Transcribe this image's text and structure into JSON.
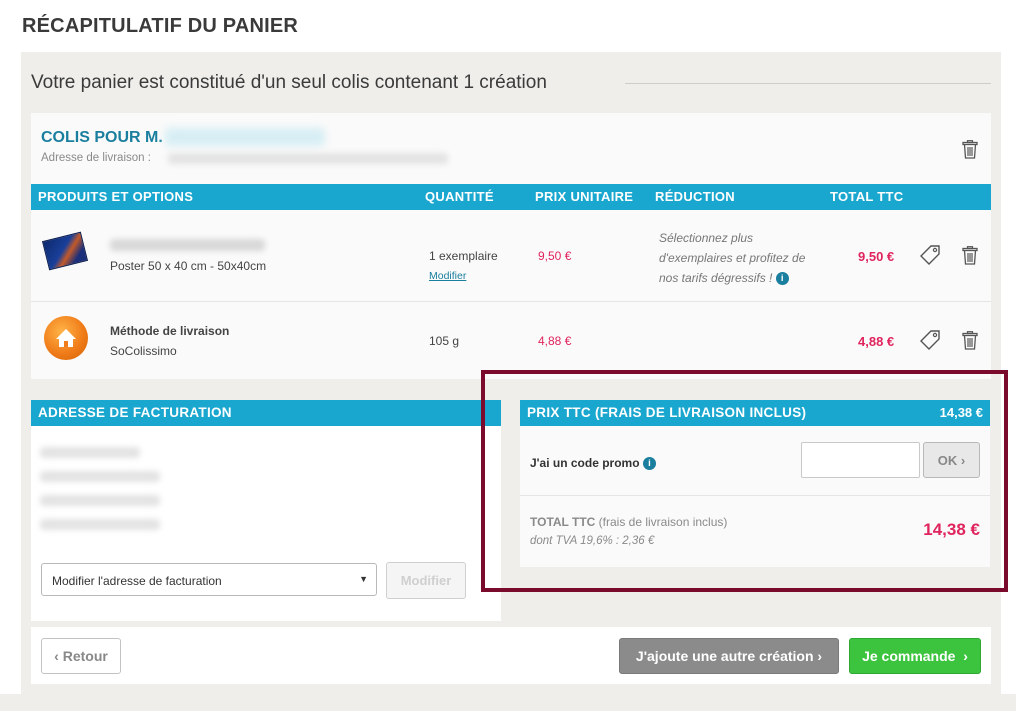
{
  "page": {
    "title": "RÉCAPITULATIF DU PANIER",
    "subtitle": "Votre panier est constitué d'un seul colis contenant 1 création"
  },
  "parcel": {
    "title": "COLIS POUR M.",
    "address_label": "Adresse de livraison :"
  },
  "table": {
    "headers": {
      "products": "PRODUITS ET OPTIONS",
      "quantity": "QUANTITÉ",
      "unit_price": "PRIX UNITAIRE",
      "reduction": "RÉDUCTION",
      "total": "TOTAL TTC"
    },
    "rows": [
      {
        "description": "Poster 50 x 40 cm - 50x40cm",
        "quantity": "1 exemplaire",
        "modify_link": "Modifier",
        "unit_price": "9,50 €",
        "reduction_text": "Sélectionnez plus d'exemplaires et profitez de nos tarifs dégressifs !",
        "total": "9,50 €"
      },
      {
        "name": "Méthode de livraison",
        "description": "SoColissimo",
        "quantity": "105 g",
        "unit_price": "4,88 €",
        "total": "4,88 €"
      }
    ]
  },
  "billing": {
    "header": "ADRESSE DE FACTURATION",
    "select_value": "Modifier l'adresse de facturation",
    "modify_button": "Modifier"
  },
  "summary": {
    "header": "PRIX TTC (FRAIS DE LIVRAISON INCLUS)",
    "header_value": "14,38 €",
    "promo_label": "J'ai un code promo",
    "ok_button": "OK",
    "total_label": "TOTAL TTC",
    "total_note": "(frais de livraison inclus)",
    "tva": "dont TVA 19,6% : 2,36 €",
    "total_value": "14,38 €"
  },
  "footer": {
    "back_button": "Retour",
    "add_button": "J'ajoute une autre création",
    "order_button": "Je commande"
  },
  "colors": {
    "accent": "#1aa7cf",
    "price": "#e0245e",
    "order_green": "#3cc43f",
    "highlight": "#7a0b2c"
  }
}
